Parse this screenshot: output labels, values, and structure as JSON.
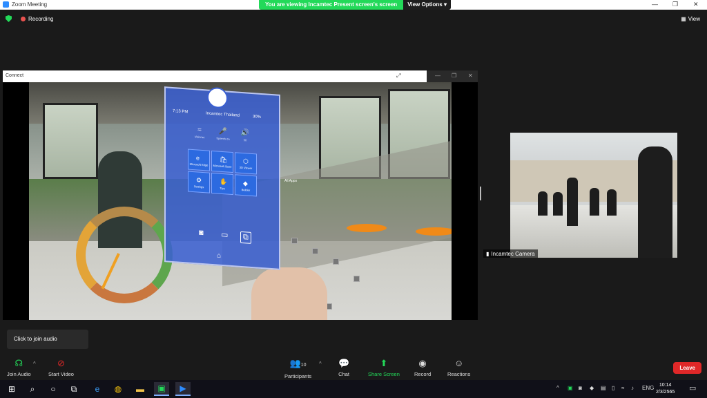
{
  "window": {
    "title": "Zoom Meeting",
    "controls": [
      "—",
      "❐",
      "✕"
    ]
  },
  "banner": {
    "message": "You are viewing Incamtec Present screen's screen",
    "view_options": "View Options"
  },
  "top": {
    "recording": "Recording",
    "view": "View"
  },
  "share": {
    "title": "Connect",
    "controls": [
      "⤢",
      "—",
      "❐",
      "✕"
    ],
    "start_menu": {
      "time": "7:13 PM",
      "device": "Incamtec Thailand",
      "battery": "30%",
      "quick": [
        {
          "icon": "≈",
          "label": "Visionet"
        },
        {
          "icon": "🎤",
          "label": "Speech on"
        },
        {
          "icon": "🔊",
          "label": "50"
        }
      ],
      "apps": [
        {
          "icon": "e",
          "label": "Microsoft Edge"
        },
        {
          "icon": "🛍",
          "label": "Microsoft Store"
        },
        {
          "icon": "⬡",
          "label": "3D Viewer"
        },
        {
          "icon": "⚙",
          "label": "Settings"
        },
        {
          "icon": "✋",
          "label": "Tips"
        },
        {
          "icon": "◆",
          "label": "Builder"
        }
      ],
      "all_apps": "All Apps"
    }
  },
  "camera": {
    "name": "Incamtec Camera"
  },
  "tooltip": "Click to join audio",
  "toolbar": {
    "join_audio": "Join Audio",
    "start_video": "Start Video",
    "participants": "Participants",
    "participants_count": "10",
    "chat": "Chat",
    "share_screen": "Share Screen",
    "record": "Record",
    "reactions": "Reactions",
    "leave": "Leave"
  },
  "taskbar": {
    "lang": "ENG",
    "time": "10:14",
    "date": "2/3/2565"
  },
  "colors": {
    "share_green": "#23d959",
    "leave_red": "#e02828",
    "zoom_blue": "#2d8cff"
  }
}
